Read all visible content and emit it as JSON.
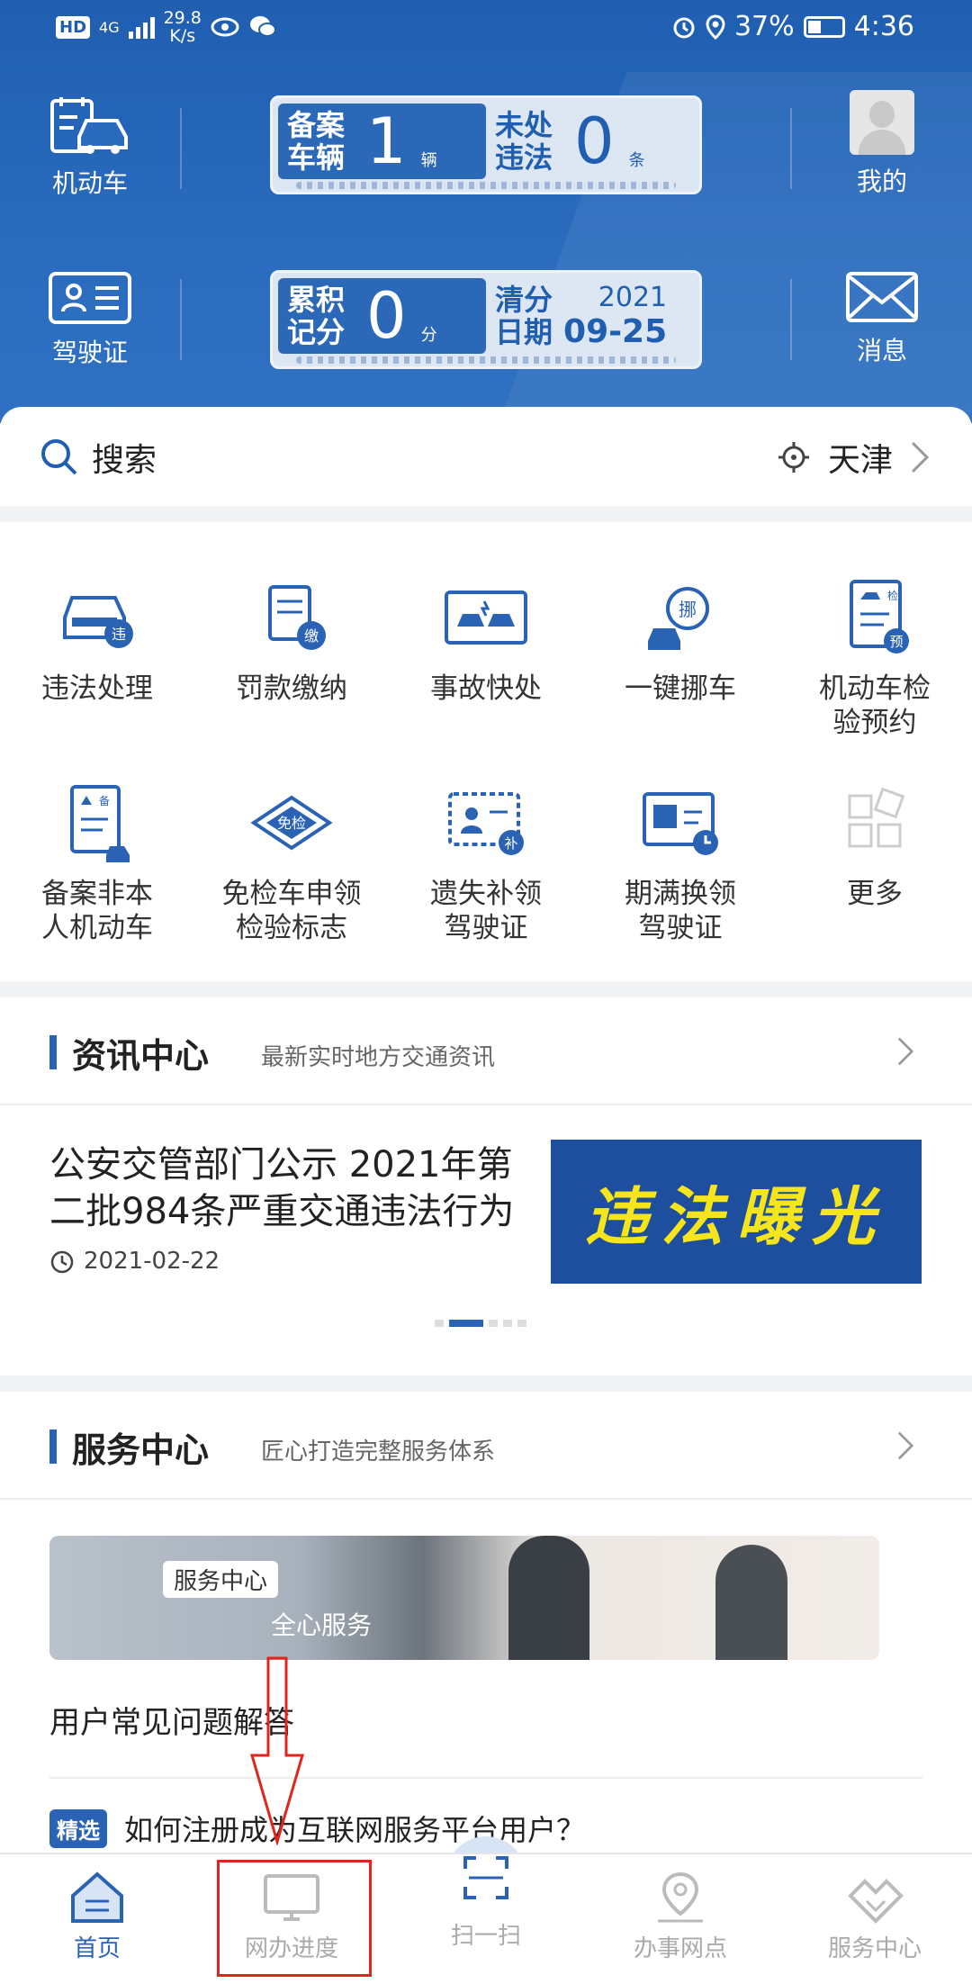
{
  "status_bar": {
    "network": "4G",
    "speed_value": "29.8",
    "speed_unit": "K/s",
    "battery": "37%",
    "time": "4:36"
  },
  "header": {
    "left_items": [
      {
        "label": "机动车",
        "icon": "car-document-icon"
      },
      {
        "label": "驾驶证",
        "icon": "id-card-icon"
      }
    ],
    "right_items": [
      {
        "label": "我的",
        "icon": "avatar"
      },
      {
        "label": "消息",
        "icon": "envelope-icon"
      }
    ],
    "plate1": {
      "left_label_l1": "备案",
      "left_label_l2": "车辆",
      "left_value": "1",
      "left_unit": "辆",
      "right_label_l1": "未处",
      "right_label_l2": "违法",
      "right_value": "0",
      "right_unit": "条"
    },
    "plate2": {
      "left_label_l1": "累积",
      "left_label_l2": "记分",
      "left_value": "0",
      "left_unit": "分",
      "right_label_l1": "清分",
      "right_label_l2": "日期",
      "year": "2021",
      "date": "09-25"
    }
  },
  "search": {
    "placeholder": "搜索",
    "city": "天津"
  },
  "services": [
    {
      "label_l1": "违法处理",
      "label_l2": "",
      "icon": "violation-car-icon"
    },
    {
      "label_l1": "罚款缴纳",
      "label_l2": "",
      "icon": "fine-payment-icon"
    },
    {
      "label_l1": "事故快处",
      "label_l2": "",
      "icon": "accident-icon"
    },
    {
      "label_l1": "一键挪车",
      "label_l2": "",
      "icon": "move-car-icon"
    },
    {
      "label_l1": "机动车检",
      "label_l2": "验预约",
      "icon": "inspection-appointment-icon"
    },
    {
      "label_l1": "备案非本",
      "label_l2": "人机动车",
      "icon": "register-vehicle-icon"
    },
    {
      "label_l1": "免检车申领",
      "label_l2": "检验标志",
      "icon": "exemption-label-icon"
    },
    {
      "label_l1": "遗失补领",
      "label_l2": "驾驶证",
      "icon": "license-reissue-icon"
    },
    {
      "label_l1": "期满换领",
      "label_l2": "驾驶证",
      "icon": "license-renew-icon"
    },
    {
      "label_l1": "更多",
      "label_l2": "",
      "icon": "more-grid-icon"
    }
  ],
  "news": {
    "title": "资讯中心",
    "subtitle": "最新实时地方交通资讯",
    "item_title": "公安交管部门公示 2021年第二批984条严重交通违法行为",
    "item_date": "2021-02-22",
    "image_text": "违法曝光",
    "carousel_active": 1,
    "carousel_count": 5
  },
  "service_center": {
    "title": "服务中心",
    "subtitle": "匠心打造完整服务体系",
    "banner_chip": "服务中心",
    "banner_slogan": "全心服务",
    "faq_title": "用户常见问题解答",
    "question_tag": "精选",
    "question": "如何注册成为互联网服务平台用户？"
  },
  "bottom_nav": [
    {
      "label": "首页",
      "icon": "home-icon",
      "active": true
    },
    {
      "label": "网办进度",
      "icon": "monitor-icon",
      "active": false
    },
    {
      "label": "扫一扫",
      "icon": "scan-icon",
      "active": false
    },
    {
      "label": "办事网点",
      "icon": "location-pin-icon",
      "active": false
    },
    {
      "label": "服务中心",
      "icon": "service-handshake-icon",
      "active": false
    }
  ],
  "colors": {
    "primary": "#2a63b4",
    "header": "#2a6bbd",
    "highlight": "#e0261c"
  }
}
